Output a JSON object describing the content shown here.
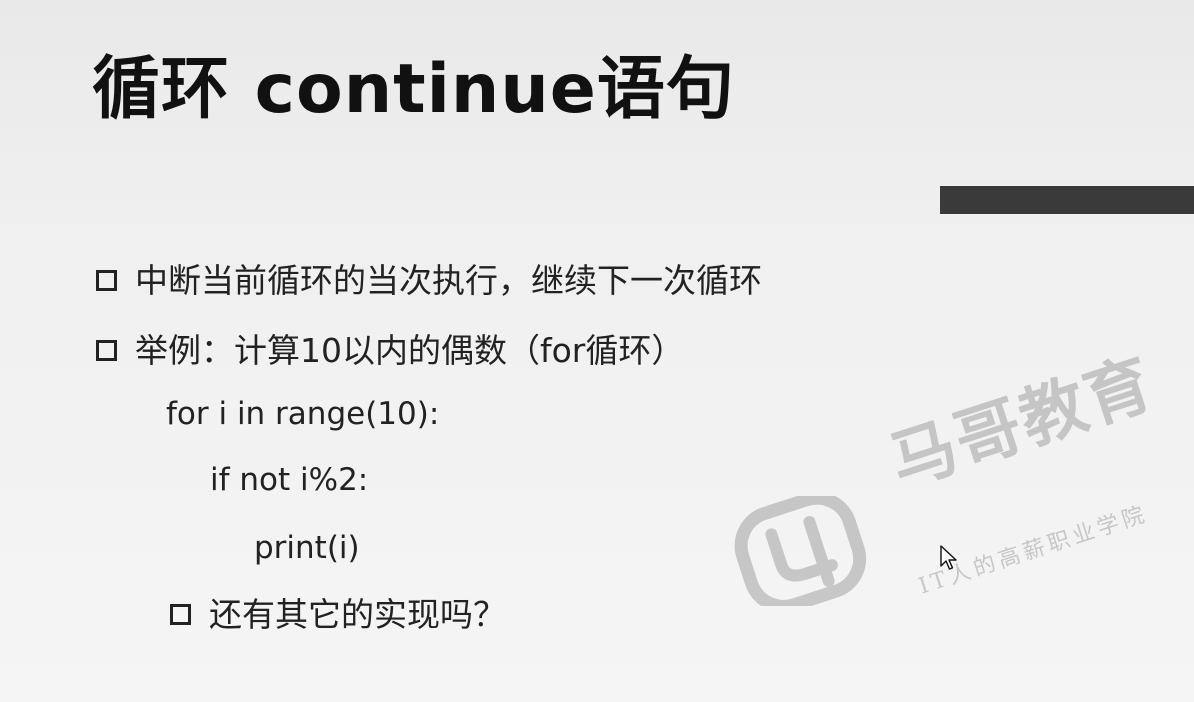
{
  "slide": {
    "title": "循环 continue语句",
    "bullets": [
      "中断当前循环的当次执行，继续下一次循环",
      "举例：计算10以内的偶数（for循环）"
    ],
    "code": [
      "for i in range(10):",
      "if not i%2:",
      "print(i)"
    ],
    "sub_bullet": "还有其它的实现吗？"
  },
  "watermark": {
    "brand": "马哥教育",
    "tagline": "IT人的高薪职业学院"
  },
  "colors": {
    "accent_bar": "#3a3a3a",
    "text": "#222222",
    "background": "#f0f0f0"
  },
  "icons": [
    "square-bullet-icon",
    "brand-logo-icon",
    "mouse-cursor-icon"
  ]
}
